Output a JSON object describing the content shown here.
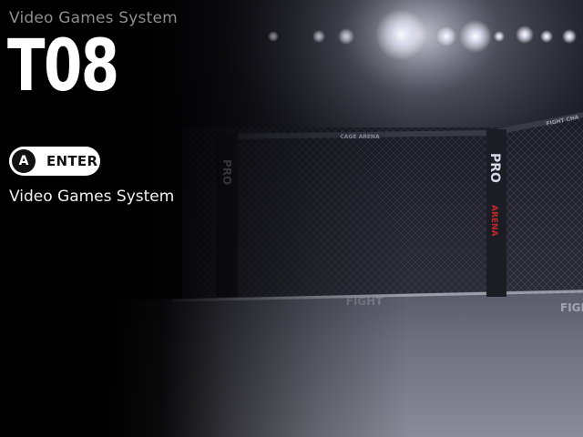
{
  "header": {
    "subtitle": "Video Games System",
    "title": "T08"
  },
  "action": {
    "button_glyph": "A",
    "label": "ENTER"
  },
  "description": "Video Games System",
  "background": {
    "arena_sign": "CAGE ARENA",
    "post_brand": "PRO",
    "post_sub": "ARENA",
    "mat_text": "FIGHT",
    "far_banner": "FIGHT CHA"
  }
}
